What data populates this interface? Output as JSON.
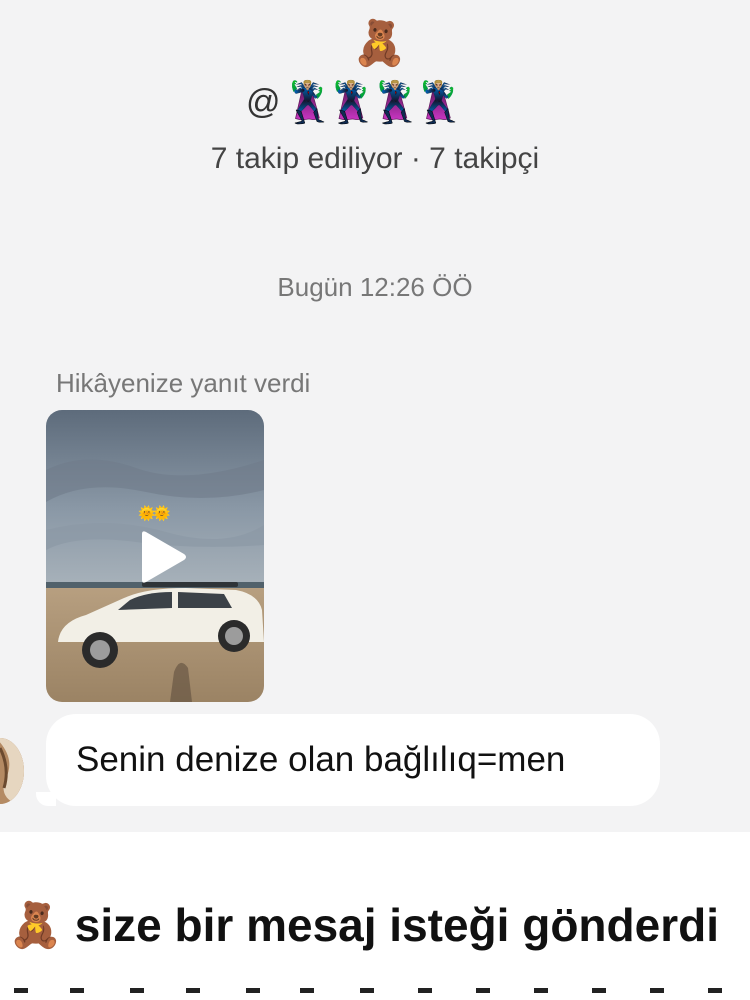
{
  "profile": {
    "emoji": "🧸",
    "username_prefix": "@",
    "username_mask": "🦹🏼‍♂️🦹🏼‍♂️🦹🏼‍♂️🦹🏼‍♂️",
    "follow_stats": "7 takip ediliyor · 7 takipçi"
  },
  "thread": {
    "timestamp": "Bugün 12:26 ÖÖ",
    "story_reply_caption": "Hikâyenize yanıt verdi",
    "story_sticker": "🌞🌞",
    "message_text": "Senin denize olan bağlılıq=men"
  },
  "request": {
    "icon": "🧸",
    "title": "size bir mesaj isteği gönderdi"
  },
  "icons": {
    "play": "play-icon",
    "teddy": "teddy-bear-icon"
  },
  "colors": {
    "chat_background": "#f3f3f4",
    "bubble": "#ffffff",
    "secondary_text": "#777777"
  }
}
